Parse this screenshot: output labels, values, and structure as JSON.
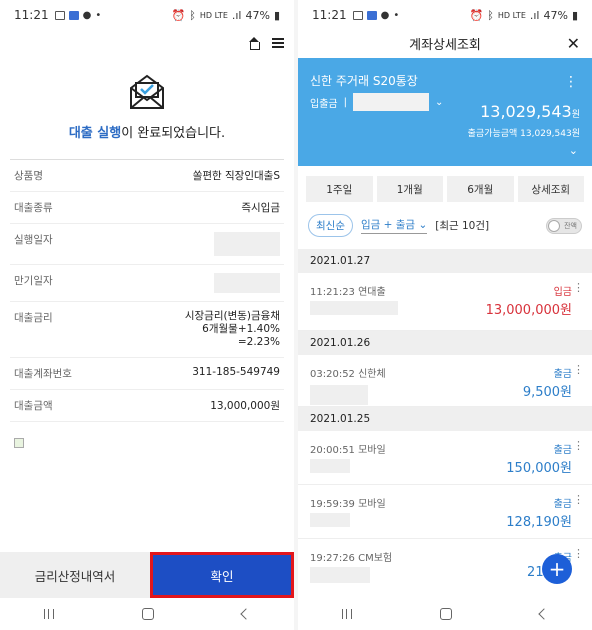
{
  "left": {
    "status": {
      "time": "11:21",
      "battery": "47%",
      "net": "HD LTE"
    },
    "message": {
      "highlight": "대출 실행",
      "rest": "이 완료되었습니다."
    },
    "info_rows": [
      {
        "label": "상품명",
        "value": "쏠편한 직장인대출S"
      },
      {
        "label": "대출종류",
        "value": "즉시입금"
      },
      {
        "label": "실행일자",
        "value": ""
      },
      {
        "label": "만기일자",
        "value": ""
      },
      {
        "label": "대출금리",
        "value": "시장금리(변동)금융채\n6개월물+1.40%\n=2.23%"
      },
      {
        "label": "대출계좌번호",
        "value": "311-185-549749"
      },
      {
        "label": "대출금액",
        "value": "13,000,000원"
      }
    ],
    "buttons": {
      "rate": "금리산정내역서",
      "confirm": "확인"
    }
  },
  "right": {
    "status": {
      "time": "11:21",
      "battery": "47%",
      "net": "HD LTE"
    },
    "title": "계좌상세조회",
    "account": {
      "name": "신한 주거래 S20통장",
      "type": "입출금",
      "balance": "13,029,543",
      "balance_unit": "원",
      "available": "출금가능금액 13,029,543원"
    },
    "periods": [
      "1주일",
      "1개월",
      "6개월",
      "상세조회"
    ],
    "filters": {
      "sort": "최신순",
      "kind": "입금 + 출금",
      "recent": "[최근 10건]",
      "toggle": "잔액"
    },
    "groups": [
      {
        "date": "2021.01.27",
        "items": [
          {
            "time": "11:21:23 연대출",
            "type": "입금",
            "amount": "13,000,000원",
            "dir": "in"
          }
        ]
      },
      {
        "date": "2021.01.26",
        "items": [
          {
            "time": "03:20:52 신한체",
            "type": "출금",
            "amount": "9,500원",
            "dir": "out"
          }
        ]
      },
      {
        "date": "2021.01.25",
        "items": [
          {
            "time": "20:00:51 모바일",
            "type": "출금",
            "amount": "150,000원",
            "dir": "out"
          },
          {
            "time": "19:59:39 모바일",
            "type": "출금",
            "amount": "128,190원",
            "dir": "out"
          },
          {
            "time": "19:27:26 CM보험",
            "type": "출금",
            "amount": "21,0",
            "dir": "out"
          }
        ]
      }
    ]
  }
}
